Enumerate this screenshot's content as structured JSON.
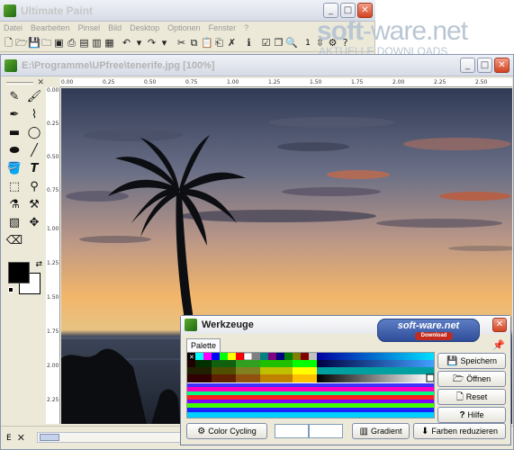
{
  "app": {
    "title": "Ultimate Paint",
    "menu": [
      "Datei",
      "Bearbeiten",
      "Pinsel",
      "Bild",
      "Desktop",
      "Optionen",
      "Fenster",
      "?"
    ],
    "zoom_level": "1"
  },
  "watermark": {
    "site_prefix": "soft",
    "site_mid": "-ware",
    "site_suffix": ".net",
    "tagline": "AKTUELLE DOWNLOADS"
  },
  "document": {
    "title": "E:\\Programme\\UPfree\\tenerife.jpg [100%]",
    "status_mode": "E",
    "hruler_labels": [
      "0.00",
      "0.25",
      "0.50",
      "0.75",
      "1.00",
      "1.25",
      "1.50",
      "1.75",
      "2.00",
      "2.25",
      "2.50"
    ],
    "vruler_labels": [
      "0.00",
      "0.25",
      "0.50",
      "0.75",
      "1.00",
      "1.25",
      "1.50",
      "1.75",
      "2.00",
      "2.25"
    ]
  },
  "werkzeuge": {
    "title": "Werkzeuge",
    "logo_text": "soft-ware.net",
    "logo_badge": "Download",
    "tab_label": "Palette",
    "buttons": {
      "save": "Speichern",
      "open": "Öffnen",
      "reset": "Reset",
      "help": "Hilfe",
      "color_cycling": "Color Cycling",
      "gradient": "Gradient",
      "reduce_colors": "Farben reduzieren"
    }
  },
  "colors": {
    "accent": "#0a246a",
    "sky_top": "#2f3a55",
    "sky_glow": "#f2b46b",
    "sea": "#2a3242"
  }
}
